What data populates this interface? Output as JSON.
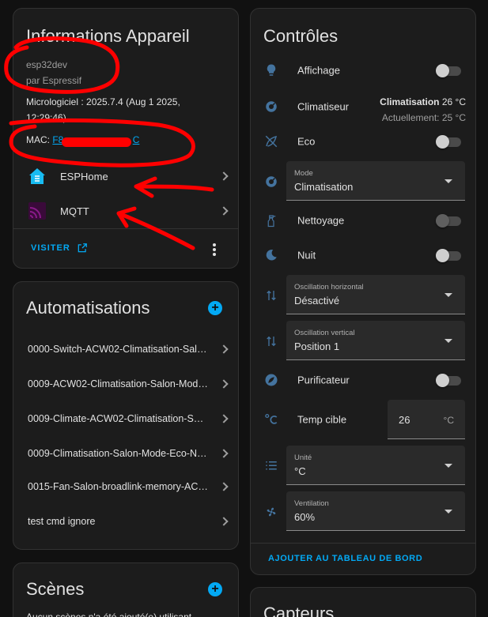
{
  "device_info": {
    "title": "Informations Appareil",
    "model": "esp32dev",
    "manufacturer": "par Espressif",
    "firmware_line1": "Micrologiciel : 2025.7.4 (Aug 1 2025,",
    "firmware_line2": "12:29:46)",
    "mac_label": "MAC: ",
    "mac_value": "F8:",
    "mac_suffix": "C",
    "integrations": [
      {
        "label": "ESPHome",
        "icon": "esphome-icon"
      },
      {
        "label": "MQTT",
        "icon": "mqtt-icon"
      }
    ],
    "visit_label": "VISITER"
  },
  "automations": {
    "title": "Automatisations",
    "items": [
      "0000-Switch-ACW02-Climatisation-Sal…",
      "0009-ACW02-Climatisation-Salon-Mod…",
      "0009-Climate-ACW02-Climatisation-Sa…",
      "0009-Climatisation-Salon-Mode-Eco-N…",
      "0015-Fan-Salon-broadlink-memory-AC…",
      "test cmd ignore"
    ]
  },
  "scenes": {
    "title": "Scènes",
    "empty_text": "Aucun scènes n'a été ajouté(e) utilisant"
  },
  "controls": {
    "title": "Contrôles",
    "affichage": "Affichage",
    "climatiseur": "Climatiseur",
    "clim_state_bold": "Climatisation",
    "clim_state_temp": " 26 °C",
    "clim_current": "Actuellement: 25 °C",
    "eco": "Eco",
    "mode_label": "Mode",
    "mode_value": "Climatisation",
    "nettoyage": "Nettoyage",
    "nuit": "Nuit",
    "osc_h_label": "Oscillation horizontal",
    "osc_h_value": "Désactivé",
    "osc_v_label": "Oscillation vertical",
    "osc_v_value": "Position 1",
    "purificateur": "Purificateur",
    "temp_cible": "Temp cible",
    "temp_value": "26",
    "temp_unit": "°C",
    "unite_label": "Unité",
    "unite_value": "°C",
    "vent_label": "Ventilation",
    "vent_value": "60%",
    "add_dashboard": "AJOUTER AU TABLEAU DE BORD"
  },
  "sensors": {
    "title": "Capteurs"
  },
  "colors": {
    "accent": "#03a9f4",
    "annotation": "#ff0000",
    "esphome": "#18bcf2",
    "mqtt": "#660066",
    "icon_blue": "#44739e"
  }
}
